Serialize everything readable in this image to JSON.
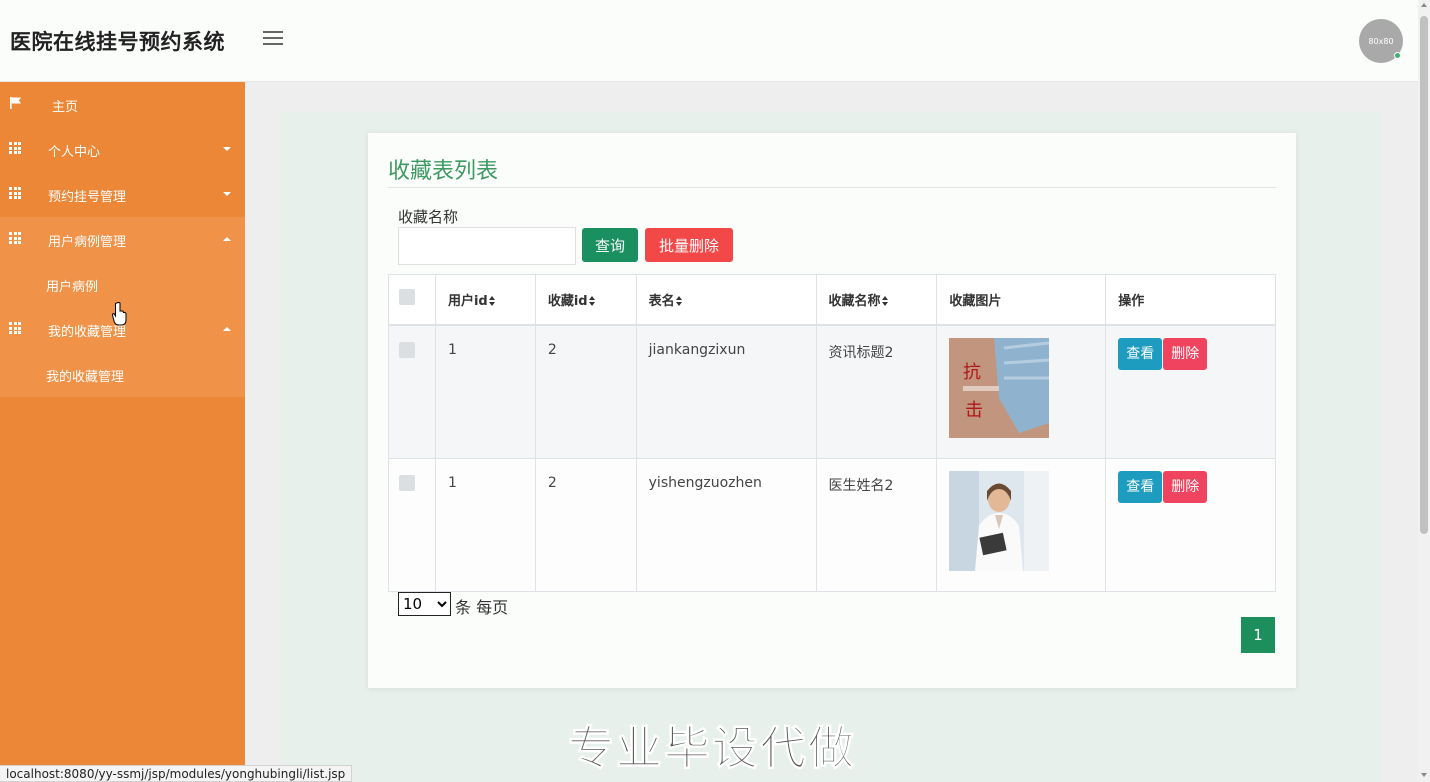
{
  "header": {
    "app_title": "医院在线挂号预约系统",
    "avatar_text": "80x80"
  },
  "sidebar": {
    "items": [
      {
        "label": "主页",
        "icon": "flag-icon"
      },
      {
        "label": "个人中心",
        "icon": "grid-icon"
      },
      {
        "label": "预约挂号管理",
        "icon": "grid-icon"
      },
      {
        "label": "用户病例管理",
        "icon": "grid-icon",
        "expanded": true,
        "children": [
          "用户病例"
        ]
      },
      {
        "label": "我的收藏管理",
        "icon": "grid-icon",
        "expanded": true,
        "children": [
          "我的收藏管理"
        ]
      }
    ]
  },
  "main": {
    "title": "收藏表列表",
    "search": {
      "label": "收藏名称",
      "value": "",
      "query_button": "查询",
      "batch_delete_button": "批量删除"
    },
    "table": {
      "columns": [
        "用户id",
        "收藏id",
        "表名",
        "收藏名称",
        "收藏图片",
        "操作"
      ],
      "rows": [
        {
          "user_id": "1",
          "fav_id": "2",
          "table_name": "jiankangzixun",
          "fav_name": "资讯标题2",
          "image": "mask-news-image"
        },
        {
          "user_id": "1",
          "fav_id": "2",
          "table_name": "yishengzuozhen",
          "fav_name": "医生姓名2",
          "image": "doctor-image"
        }
      ],
      "view_label": "查看",
      "delete_label": "删除"
    },
    "pagination": {
      "page_size": "10",
      "page_size_options": [
        "10"
      ],
      "per_page_label": "条 每页",
      "current_page": "1"
    }
  },
  "watermark": "专业毕设代做",
  "status_url": "localhost:8080/yy-ssmj/jsp/modules/yonghubingli/list.jsp",
  "colors": {
    "sidebar": "#ec8737",
    "sidebar_open": "#f09248",
    "accent_green": "#1a8f5f",
    "danger": "#f24848",
    "info": "#1e9cbf"
  }
}
